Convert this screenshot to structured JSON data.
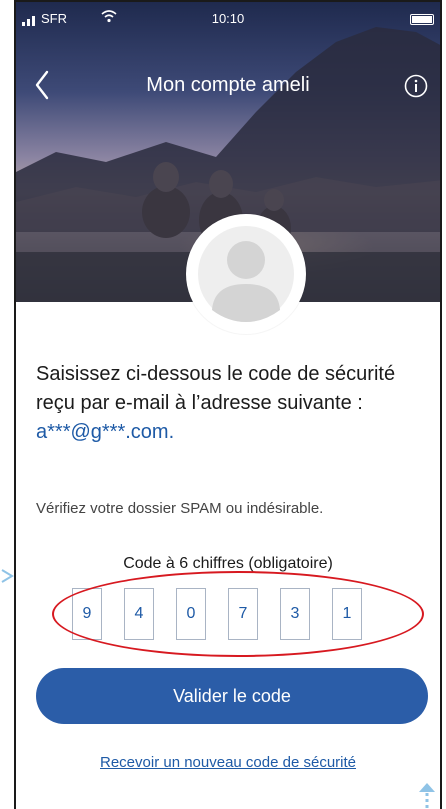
{
  "status_bar": {
    "carrier": "SFR",
    "time": "10:10"
  },
  "nav": {
    "title": "Mon compte ameli",
    "back_icon": "chevron-left-icon",
    "info_icon": "info-icon"
  },
  "main": {
    "headline": "Saisissez ci-dessous le code de sécurité reçu par e-mail à l’adresse suivante :",
    "email": "a***@g***.com.",
    "spam_note": "Vérifiez votre dossier SPAM ou indésirable.",
    "code_label": "Code à 6 chiffres (obligatoire)",
    "code_digits": [
      "9",
      "4",
      "0",
      "7",
      "3",
      "1"
    ],
    "submit_label": "Valider le code",
    "resend_label": "Recevoir un nouveau code de sécurité"
  },
  "colors": {
    "primary": "#2b5da8",
    "link": "#1e5aa6",
    "annotation_red": "#d71920",
    "annotation_arrow": "#8fc3e6"
  }
}
